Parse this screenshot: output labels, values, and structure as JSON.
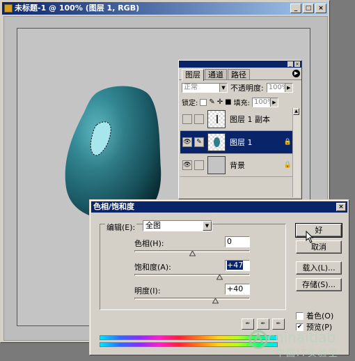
{
  "document": {
    "title": "未标题-1 @ 100% (图层 1, RGB)",
    "buttons": {
      "minimize": "_",
      "maximize": "□",
      "close": "×"
    }
  },
  "layers_panel": {
    "tabs": [
      {
        "label": "图层",
        "active": true
      },
      {
        "label": "通道",
        "active": false
      },
      {
        "label": "路径",
        "active": false
      }
    ],
    "blend_mode": "正常",
    "opacity_label": "不透明度:",
    "opacity_value": "100%",
    "lock_label": "锁定:",
    "fill_label": "填充:",
    "fill_value": "100%",
    "layers": [
      {
        "name": "图层 1 副本",
        "visible": false,
        "selected": false
      },
      {
        "name": "图层 1",
        "visible": true,
        "selected": true
      },
      {
        "name": "背景",
        "visible": true,
        "selected": false
      }
    ]
  },
  "hue_sat_dialog": {
    "title": "色相/饱和度",
    "edit_label": "编辑(E):",
    "edit_value": "全图",
    "sliders": [
      {
        "label": "色相(H):",
        "value": "0",
        "position": 0.5
      },
      {
        "label": "饱和度(A):",
        "value": "+47",
        "position": 0.735
      },
      {
        "label": "明度(I):",
        "value": "+40",
        "position": 0.7
      }
    ],
    "buttons": {
      "ok": "好",
      "cancel": "取消",
      "load": "载入(L)...",
      "save": "存储(S)..."
    },
    "colorize_label": "着色(O)",
    "colorize_checked": false,
    "preview_label": "预览(P)",
    "preview_checked": true
  },
  "watermark": {
    "brand": "chinaitlab",
    "subtitle": "中国IT实验室"
  },
  "colors": {
    "titlebar": "#0a246a",
    "face": "#d4d0c8",
    "shape": "#2e7f8c"
  }
}
